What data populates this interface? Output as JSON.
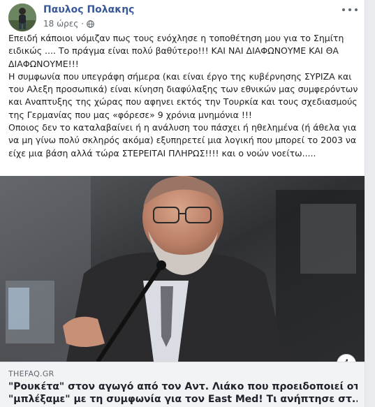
{
  "post": {
    "author": "Παυλος Πολακης",
    "time": "18 ώρες",
    "separator": "·",
    "privacy_icon": "globe-icon",
    "more_icon": "more-options-icon",
    "text_lines": [
      "Επειδή κάποιοι νόμιζαν πως τους ενόχλησε η τοποθέτηση μου για το Σημίτη",
      "ειδικώς .... Το πράγμα είναι πολύ βαθύτερο!!! ΚΑΙ ΝΑΙ ΔΙΑΦΩΝΟΥΜΕ ΚΑΙ ΘΑ",
      "ΔΙΑΦΩΝΟΥΜΕ!!!",
      "Η συμφωνία που υπεγράφη σήμερα (και είναι έργο της κυβέρνησης ΣΥΡΙΖΑ και",
      "του Αλεξη προσωπικά) είναι κίνηση διαφύλαξης των εθνικών μας συμφερόντων",
      "και Αναπτυξης της χώρας που αφηνει εκτός την Τουρκία και τους σχεδιασμούς",
      "της Γερμανίας που μας «φόρεσε» 9 χρόνια μνημόνια !!!",
      "Οποιος δεν το καταλαβαίνει ή η ανάλυση του πάσχει ή ηθελημένα (ή άθελα για",
      "να μη γίνω πολύ σκληρός ακόμα) εξυπηρετεί μια λογική που μπορεί το 2003 να",
      "είχε μια βάση αλλά τώρα ΣΤΕΡΕΙΤΑΙ ΠΛΗΡΩΣ!!!! και ο νοών νοείτω....."
    ]
  },
  "link": {
    "domain": "THEFAQ.GR",
    "title_lines": [
      "\"Ρουκέτα\" στον αγωγό από τον Αντ. Λιάκο που προειδοποιεί οτι",
      "\"μπλέξαμε\" με τη συμφωνία για τον East Med! Τι ανήπτησε στ..."
    ],
    "info_label": "i"
  }
}
